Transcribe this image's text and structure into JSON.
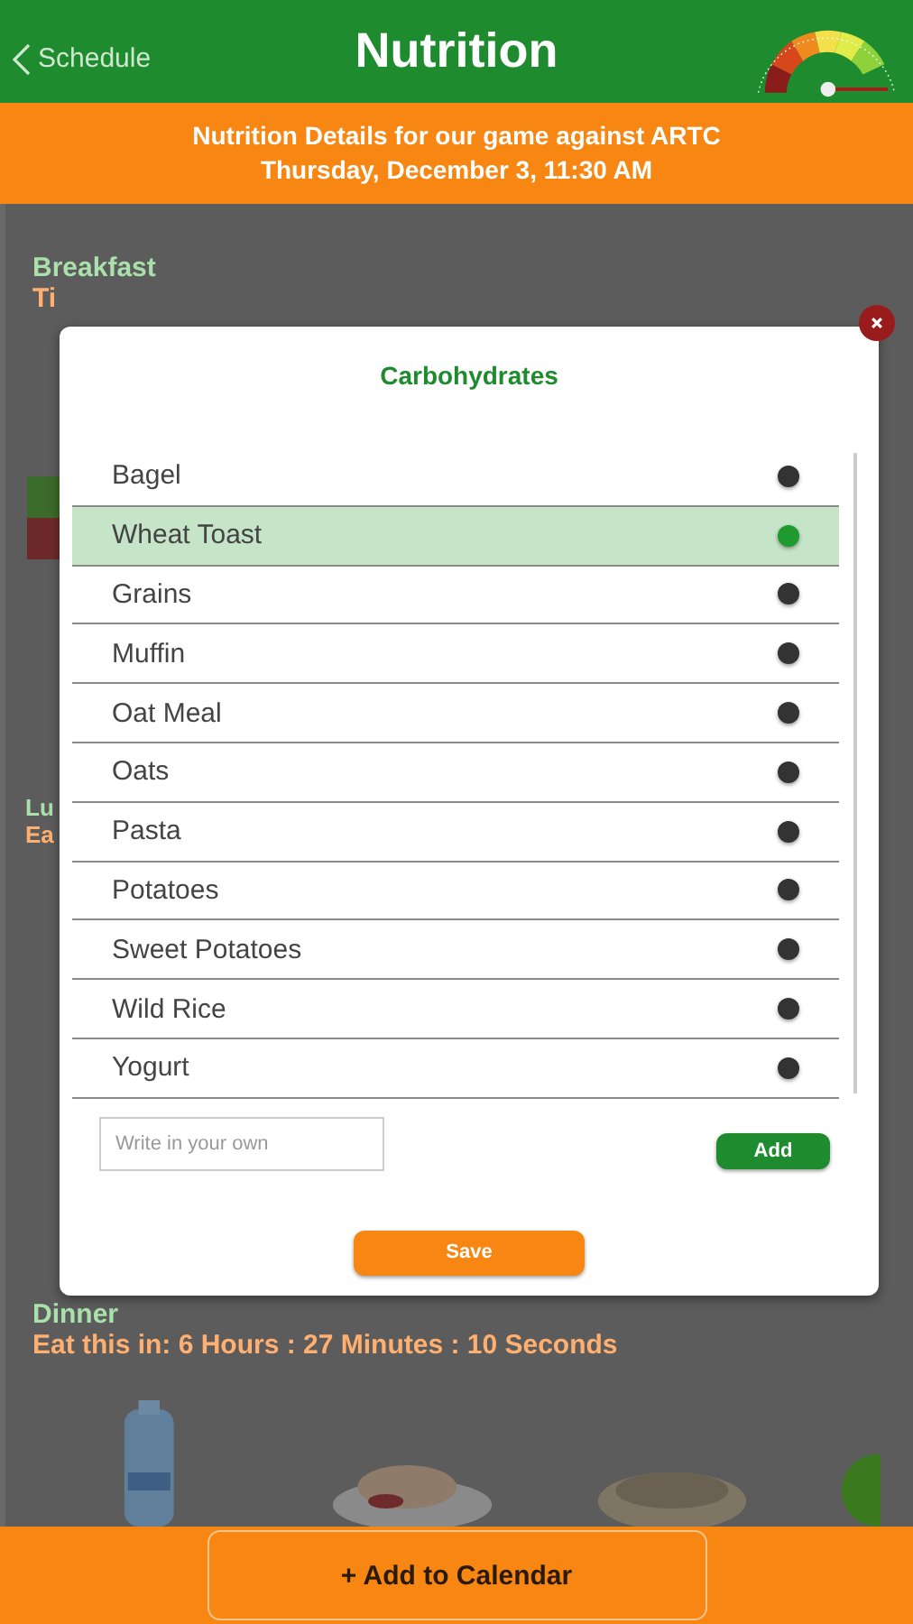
{
  "header": {
    "back": "Schedule",
    "title": "Nutrition"
  },
  "banner": {
    "line_1": "Nutrition Details for our game against ARTC",
    "line_2": "Thursday, December 3, 11:30 AM"
  },
  "meals": [
    {
      "title": "Breakfast",
      "countdown": "Ti"
    },
    {
      "title": "Lu",
      "countdown": "Ea"
    },
    {
      "title": "Dinner",
      "countdown": "Eat this in: 6 Hours : 27 Minutes : 10 Seconds"
    }
  ],
  "dialog": {
    "title": "Carbohydrates",
    "items": [
      {
        "label": "Bagel",
        "selected": false
      },
      {
        "label": "Wheat Toast",
        "selected": true
      },
      {
        "label": "Grains",
        "selected": false
      },
      {
        "label": "Muffin",
        "selected": false
      },
      {
        "label": "Oat Meal",
        "selected": false
      },
      {
        "label": "Oats",
        "selected": false
      },
      {
        "label": "Pasta",
        "selected": false
      },
      {
        "label": "Potatoes",
        "selected": false
      },
      {
        "label": "Sweet Potatoes",
        "selected": false
      },
      {
        "label": "Wild Rice",
        "selected": false
      },
      {
        "label": "Yogurt",
        "selected": false
      }
    ],
    "input": {
      "placeholder": "Write in your own"
    },
    "add": "Add",
    "save": "Save"
  },
  "footer": {
    "button": "+ Add to Calendar"
  }
}
